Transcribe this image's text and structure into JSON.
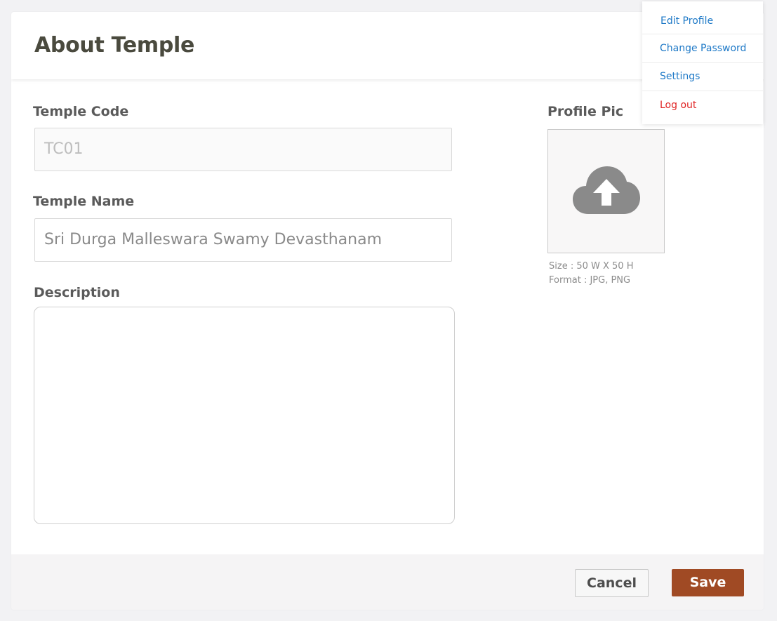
{
  "page": {
    "title": "About Temple"
  },
  "form": {
    "temple_code": {
      "label": "Temple Code",
      "value": "TC01"
    },
    "temple_name": {
      "label": "Temple Name",
      "value": "Sri Durga Malleswara Swamy Devasthanam"
    },
    "description": {
      "label": "Description",
      "value": ""
    },
    "profile_pic": {
      "label": "Profile Pic",
      "icon": "cloud-upload-icon",
      "size_hint": "Size : 50 W X 50 H",
      "format_hint": "Format : JPG, PNG"
    }
  },
  "footer": {
    "cancel_label": "Cancel",
    "save_label": "Save"
  },
  "user_menu": {
    "items": [
      {
        "label": "Edit Profile"
      },
      {
        "label": "Change Password"
      },
      {
        "label": "Settings"
      },
      {
        "label": "Log out"
      }
    ]
  },
  "colors": {
    "accent": "#a04a24",
    "link": "#1e79c7",
    "danger": "#e02424"
  }
}
